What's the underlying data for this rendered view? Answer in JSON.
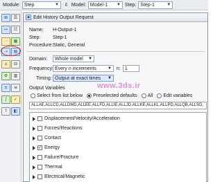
{
  "toolbar": {
    "module_label": "Module:",
    "module_value": "Step",
    "model_label": "Model:",
    "model_value": "Model-1",
    "step_label": "Step:",
    "step_value": "Step-1"
  },
  "palette": {
    "tools": [
      "field-output-icon",
      "history-output-icon",
      "time-points-icon",
      "adaptive-mesh-icon",
      "general-solution-icon",
      "solver-controls-icon"
    ]
  },
  "dialog": {
    "title": "Edit History Output Request",
    "name_label": "Name:",
    "name_value": "H-Output-1",
    "step_label": "Step:",
    "step_value": "Step-1",
    "procedure_label": "Procedure:",
    "procedure_value": "Static, General",
    "domain_label": "Domain:",
    "domain_value": "Whole model",
    "frequency_label": "Frequency:",
    "frequency_value": "Every n increments",
    "n_label": "n:",
    "n_value": "1",
    "timing_label": "Timing:",
    "timing_value": "Output at exact times",
    "output_variables_label": "Output Variables",
    "radio_options": [
      {
        "label": "Select from list below",
        "selected": false
      },
      {
        "label": "Preselected defaults",
        "selected": true
      },
      {
        "label": "All",
        "selected": false
      },
      {
        "label": "Edit variables",
        "selected": false
      }
    ],
    "variables_text": "ALLAE,ALLCD,ALLDMD,ALLEE,ALLFD,ALLIE,ALLJD,ALLKE,ALLKL,ALLPD,ALLQB,ALLSD,",
    "categories": [
      {
        "label": "Displacement/Velocity/Acceleration",
        "checked": false
      },
      {
        "label": "Forces/Reactions",
        "checked": false
      },
      {
        "label": "Contact",
        "checked": false
      },
      {
        "label": "Energy",
        "checked": true
      },
      {
        "label": "Failure/Fracture",
        "checked": false
      },
      {
        "label": "Thermal",
        "checked": false
      },
      {
        "label": "Electrical/Magnetic",
        "checked": false
      }
    ]
  },
  "watermark": "www.3ds.ir"
}
